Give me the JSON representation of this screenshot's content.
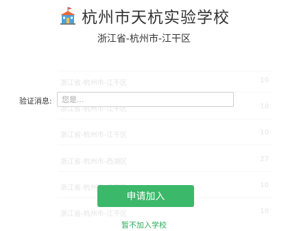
{
  "header": {
    "school_name": "杭州市天杭实验学校",
    "region": "浙江省-杭州市-江干区",
    "icon": "school-building-icon"
  },
  "verify": {
    "label": "验证消息:",
    "placeholder": "您是...",
    "value": ""
  },
  "actions": {
    "apply_label": "申请加入",
    "skip_label": "暂不加入学校"
  },
  "background_list": {
    "rows": [
      {
        "name": "浙江省-杭州市-江干区",
        "count": "10"
      },
      {
        "name": "浙江省-杭州市-江干区",
        "count": "10"
      },
      {
        "name": "浙江省-杭州市-江干区",
        "count": "10"
      },
      {
        "name": "浙江省-杭州市-西湖区",
        "count": "27"
      },
      {
        "name": "浙江省-杭州市-江干区",
        "count": "10"
      },
      {
        "name": "浙江省-杭州市-江干区",
        "count": "10"
      }
    ]
  },
  "colors": {
    "primary_green": "#3cb86a",
    "link_green": "#2eaa5c",
    "text": "#333333"
  }
}
